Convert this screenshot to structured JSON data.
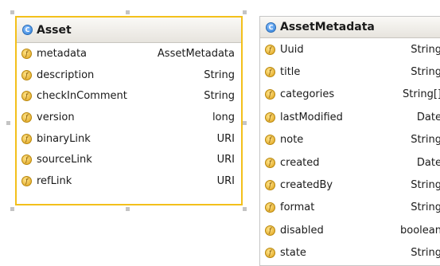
{
  "classes": [
    {
      "name": "Asset",
      "kind_glyph": "C",
      "fields": [
        {
          "name": "metadata",
          "type": "AssetMetadata"
        },
        {
          "name": "description",
          "type": "String"
        },
        {
          "name": "checkInComment",
          "type": "String"
        },
        {
          "name": "version",
          "type": "long"
        },
        {
          "name": "binaryLink",
          "type": "URI"
        },
        {
          "name": "sourceLink",
          "type": "URI"
        },
        {
          "name": "refLink",
          "type": "URI"
        }
      ]
    },
    {
      "name": "AssetMetadata",
      "kind_glyph": "C",
      "fields": [
        {
          "name": "Uuid",
          "type": "String"
        },
        {
          "name": "title",
          "type": "String"
        },
        {
          "name": "categories",
          "type": "String[]"
        },
        {
          "name": "lastModified",
          "type": "Date"
        },
        {
          "name": "note",
          "type": "String"
        },
        {
          "name": "created",
          "type": "Date"
        },
        {
          "name": "createdBy",
          "type": "String"
        },
        {
          "name": "format",
          "type": "String"
        },
        {
          "name": "disabled",
          "type": "boolean"
        },
        {
          "name": "state",
          "type": "String"
        }
      ]
    }
  ],
  "field_glyph": "f",
  "colors": {
    "selection_border": "#f3c01b",
    "class_icon": "#2f7fd6",
    "field_icon": "#e0a21a",
    "selection_handle": "#c4c4c4"
  }
}
